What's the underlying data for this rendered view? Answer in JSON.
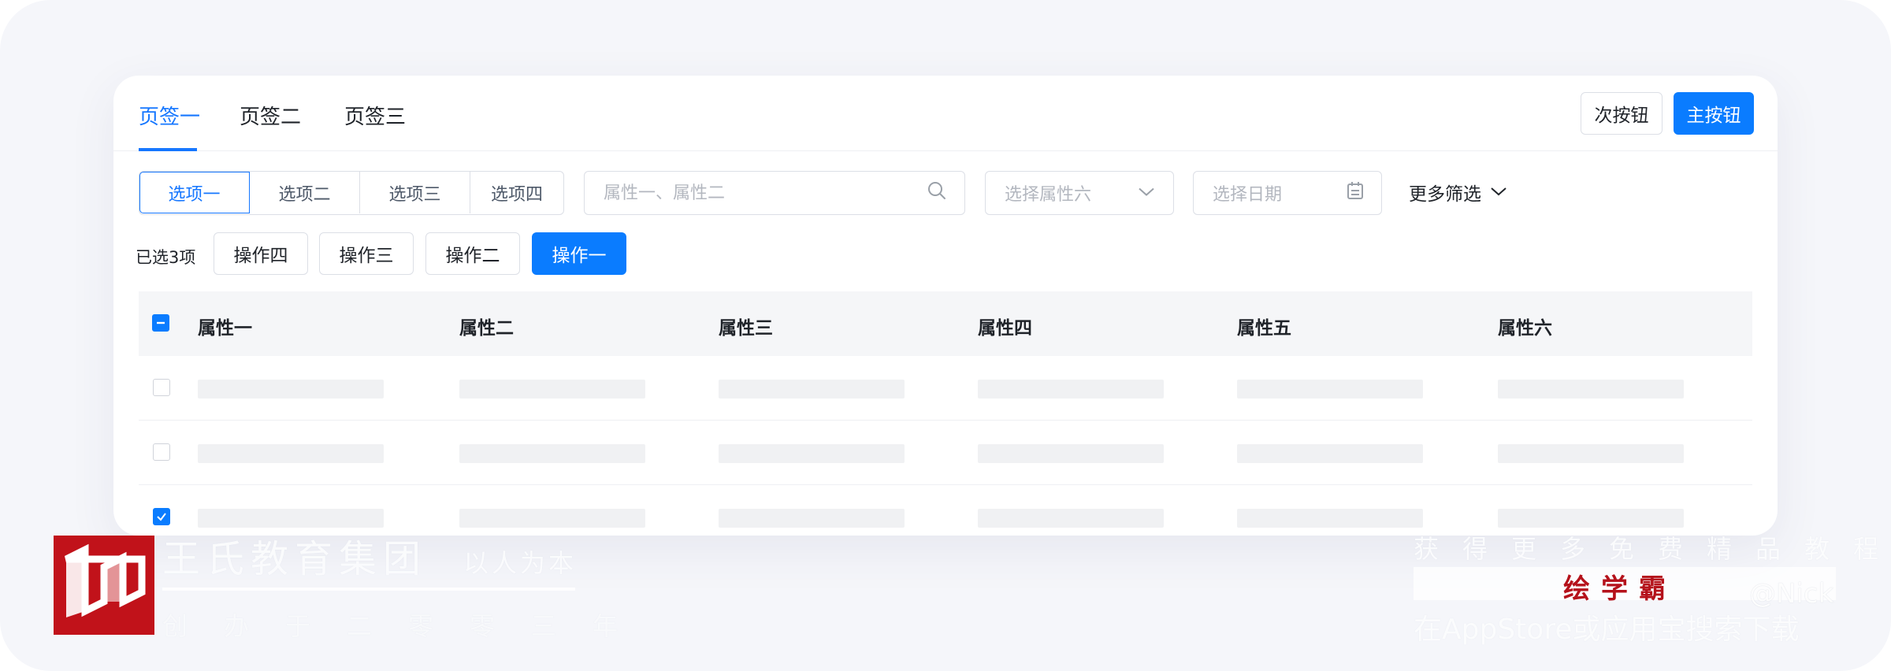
{
  "tabs": [
    {
      "label": "页签一",
      "active": true
    },
    {
      "label": "页签二",
      "active": false
    },
    {
      "label": "页签三",
      "active": false
    }
  ],
  "header_actions": {
    "secondary_label": "次按钮",
    "primary_label": "主按钮"
  },
  "segmented": [
    {
      "label": "选项一",
      "active": true
    },
    {
      "label": "选项二",
      "active": false
    },
    {
      "label": "选项三",
      "active": false
    },
    {
      "label": "选项四",
      "active": false
    }
  ],
  "search": {
    "placeholder": "属性一、属性二",
    "value": ""
  },
  "attribute_select": {
    "placeholder": "选择属性六"
  },
  "date_picker": {
    "placeholder": "选择日期"
  },
  "more_filters_label": "更多筛选",
  "batch": {
    "selected_text": "已选3项",
    "operations": [
      {
        "label": "操作四",
        "primary": false
      },
      {
        "label": "操作三",
        "primary": false
      },
      {
        "label": "操作二",
        "primary": false
      },
      {
        "label": "操作一",
        "primary": true
      }
    ]
  },
  "table": {
    "select_all_state": "indeterminate",
    "columns": [
      "属性一",
      "属性二",
      "属性三",
      "属性四",
      "属性五",
      "属性六"
    ],
    "rows": [
      {
        "checked": false,
        "cells": [
          "",
          "",
          "",
          "",
          "",
          ""
        ]
      },
      {
        "checked": false,
        "cells": [
          "",
          "",
          "",
          "",
          "",
          ""
        ]
      },
      {
        "checked": true,
        "cells": [
          "",
          "",
          "",
          "",
          "",
          ""
        ]
      }
    ]
  },
  "branding": {
    "company": "王氏教育集团",
    "slogan": "以人为本",
    "since": "创办于二零零三年",
    "promo_line1": "获得更多免费精品教程",
    "promo_brand": "绘学霸",
    "promo_line2": "在AppStore或应用宝搜索下载",
    "signature": "@Nick"
  },
  "colors": {
    "accent": "#0a7cff",
    "active_text": "#1677ff",
    "brand_red": "#c1121a"
  }
}
